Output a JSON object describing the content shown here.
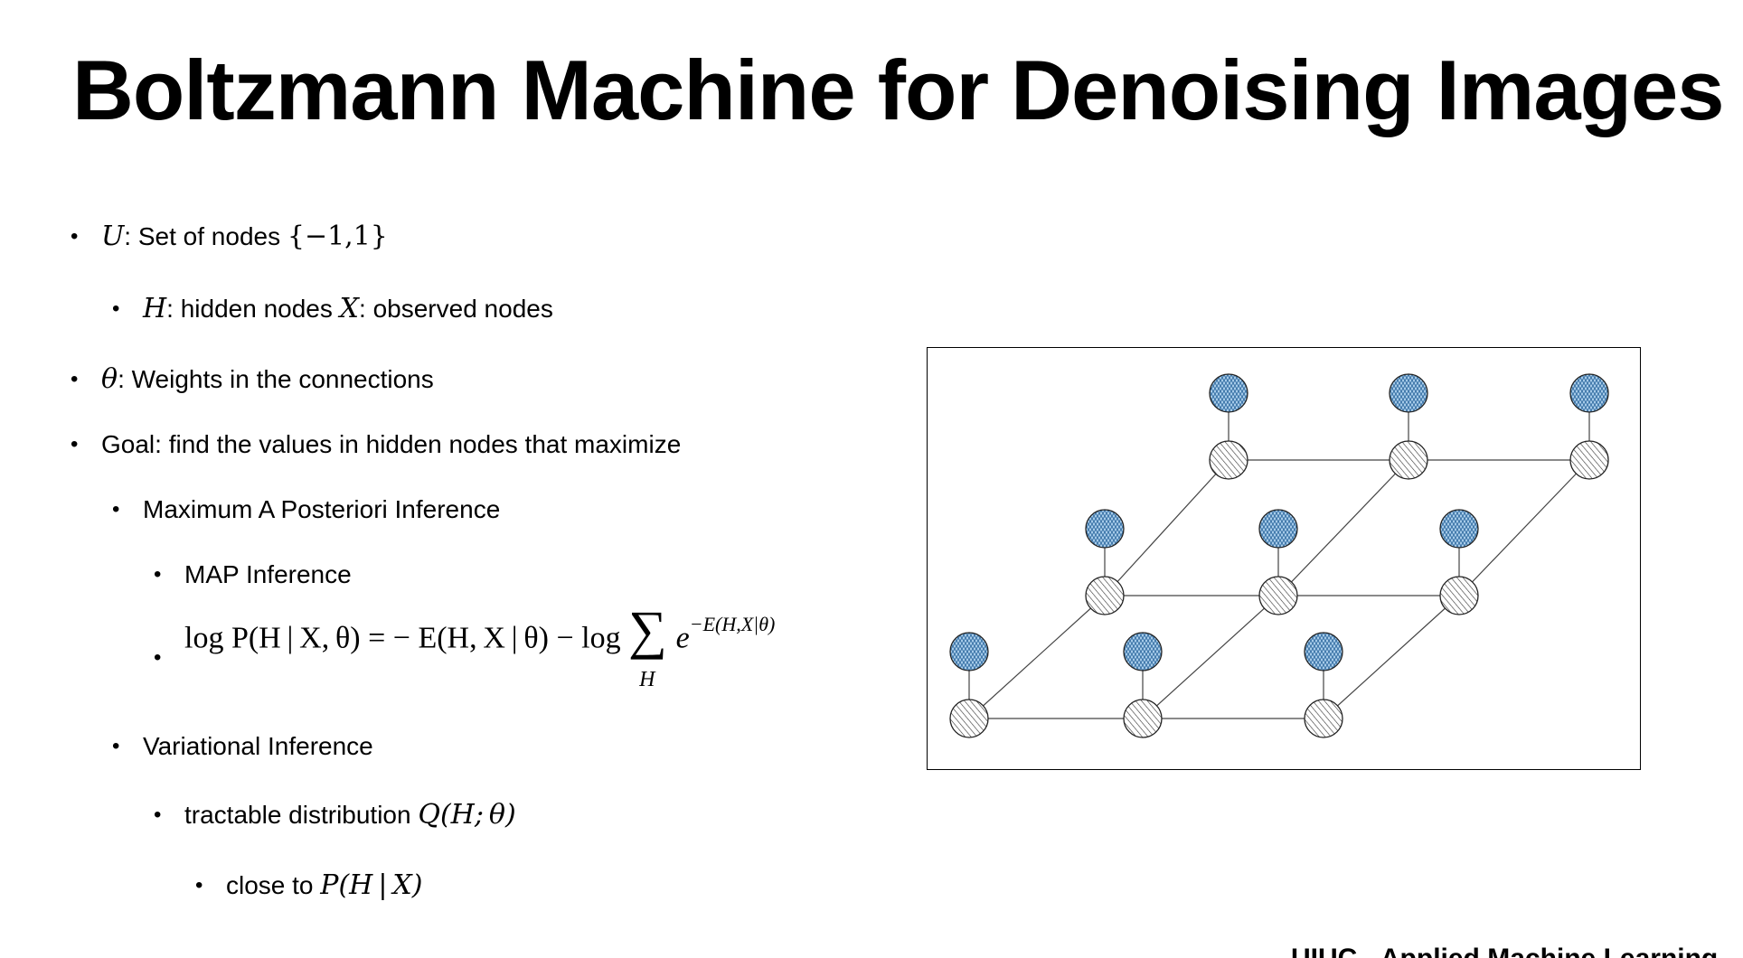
{
  "title": "Boltzmann Machine for Denoising Images",
  "bullets": {
    "b1": {
      "sym": "U",
      "text": ": Set of nodes ",
      "set": "{−1,1}"
    },
    "b1a": {
      "sym1": "H",
      "text1": ": hidden nodes ",
      "sym2": "X",
      "text2": ": observed nodes"
    },
    "b2": {
      "sym": "θ",
      "text": ": Weights in the connections"
    },
    "b3": {
      "text": "Goal: find the values in hidden nodes that maximize"
    },
    "b3a": {
      "text": "Maximum A Posteriori Inference"
    },
    "b3a1": {
      "text": "MAP Inference"
    },
    "b4": {
      "text": "Variational Inference"
    },
    "b4a": {
      "text": "tractable distribution ",
      "math": "Q(H; θ)"
    },
    "b4a1": {
      "text": "close to ",
      "math": "P(H | X)"
    }
  },
  "formula": {
    "lhs": "log P(H | X, θ) = − E(H, X | θ) − log",
    "sum": "∑",
    "sum_sub": "H",
    "base": "e",
    "exponent": "−E(H,X|θ)"
  },
  "bullet_glyph": "•",
  "footer": "UIUC - Applied Machine Learning",
  "colors": {
    "observed_fill": "#a9cdea",
    "observed_hatch": "#2f6aa0",
    "hidden_fill": "#ffffff",
    "hidden_hatch": "#333333",
    "edge": "#444444"
  }
}
